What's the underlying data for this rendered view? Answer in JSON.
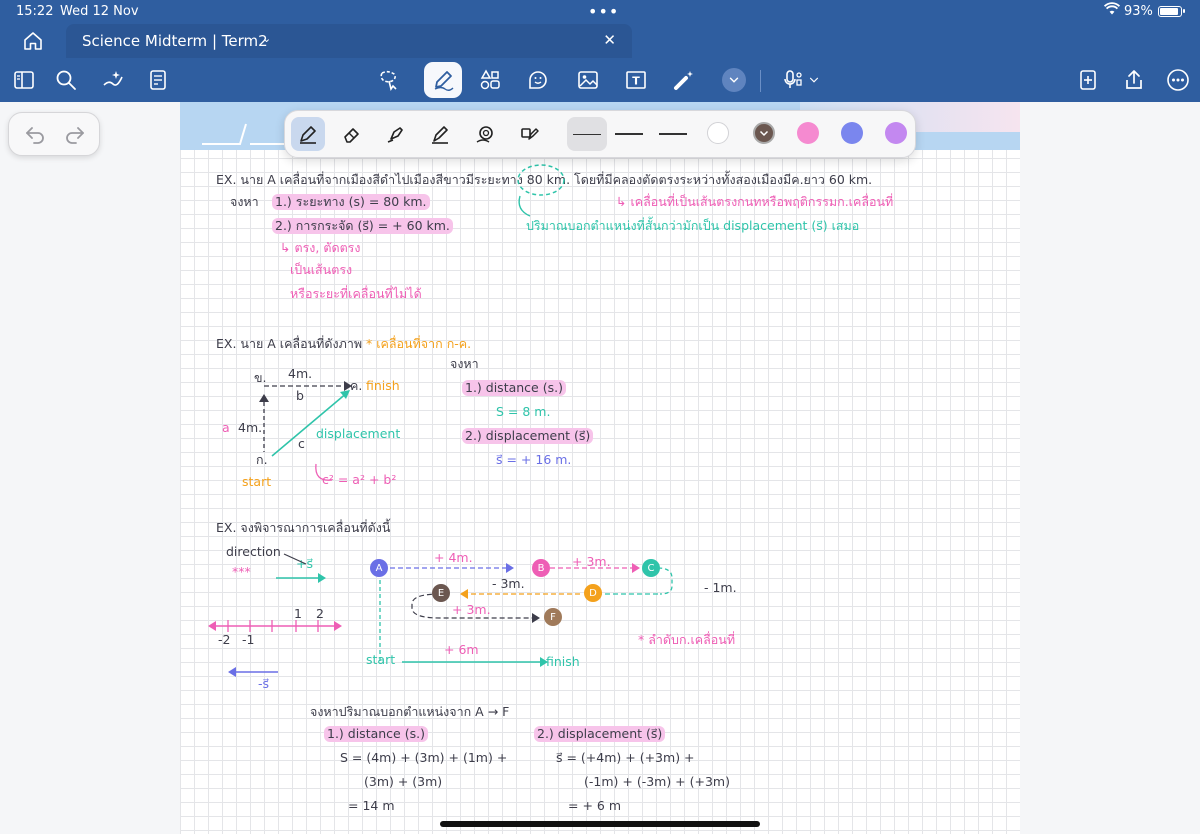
{
  "status": {
    "time": "15:22",
    "date": "Wed 12 Nov",
    "battery": "93%",
    "battery_level": 0.93
  },
  "tab": {
    "title": "Science Midterm | Term2"
  },
  "note": {
    "ex1": {
      "line1": "EX. นาย A เคลื่อนที่จากเมืองสีดำไปเมืองสีขาวมีระยะทาง 80 km. โดยที่มีคลองตัดตรงระหว่างทั้งสองเมืองมีค.ยาว 60 km.",
      "find": "จงหา",
      "q1": "1.) ระยะทาง (s) = 80 km.",
      "q2": "2.) การกระจัด (s⃗) = + 60 km.",
      "note1": "↳ ตรง, ตัดตรง",
      "note2": "เป็นเส้นตรง",
      "note3": "หรือระยะที่เคลื่อนที่ไม่ได้",
      "right1": "↳ เคลื่อนที่เป็นเส้นตรงกนทหรือพฤติกรรมก.เคลื่อนที่",
      "right2": "ปริมาณบอกตำแหน่งที่สั้นกว่ามักเป็น displacement (s⃗) เสมอ"
    },
    "ex2": {
      "title": "EX. นาย A เคลื่อนที่ดังภาพ",
      "star": "* เคลื่อนที่จาก ก-ค.",
      "label_b": "ข.",
      "label_c": "ค.",
      "label_a": "ก.",
      "top_dist": "4m.",
      "side_dist": "4m.",
      "lbl_side_a": "a",
      "lbl_top_b": "b",
      "lbl_hyp_c": "c",
      "finish": "finish",
      "start": "start",
      "displacement": "displacement",
      "formula": "c² = a² + b²",
      "find": "จงหา",
      "q1": "1.) distance (s.)",
      "a1": "S = 8 m.",
      "q2": "2.) displacement (s⃗)",
      "a2": "s⃗ = + 16 m."
    },
    "ex3": {
      "title": "EX. จงพิจารณาการเคลื่อนที่ดังนี้",
      "direction": "direction",
      "plus_s": "+s⃗",
      "stars": "***",
      "minus_s": "-s⃗",
      "nl_labels": [
        "-2",
        "-1",
        "1",
        "2"
      ],
      "nodes": [
        "A",
        "B",
        "C",
        "D",
        "E",
        "F"
      ],
      "seg_ab": "+ 4m.",
      "seg_bc": "+ 3m.",
      "seg_cd": "- 1m.",
      "seg_de": "- 3m.",
      "seg_ef": "+ 3m.",
      "total": "+ 6m",
      "start": "start",
      "finish": "finish",
      "star_note": "* ลำดับก.เคลื่อนที่",
      "find": "จงหาปริมาณบอกตำแหน่งจาก A → F",
      "q1": "1.) distance (s.)",
      "d1": "S = (4m) + (3m) + (1m) +",
      "d2": "(3m) + (3m)",
      "d3": "= 14 m",
      "q2": "2.) displacement (s⃗)",
      "s1": "s⃗ = (+4m) + (+3m) +",
      "s2": "(-1m) + (-3m) + (+3m)",
      "s3": "= + 6 m"
    }
  },
  "colors": {
    "toolbar": "#2f5ea0",
    "pink": "#ee5eb5",
    "teal": "#2fc4aa",
    "orange": "#f4a11c",
    "blue": "#6a6fe6",
    "node_brown": "#a07a5a",
    "node_dark": "#6b5750"
  },
  "pen_colors": [
    "#ffffff",
    "#6b5750",
    "#f58ad0",
    "#7a86ee",
    "#c388f0"
  ]
}
